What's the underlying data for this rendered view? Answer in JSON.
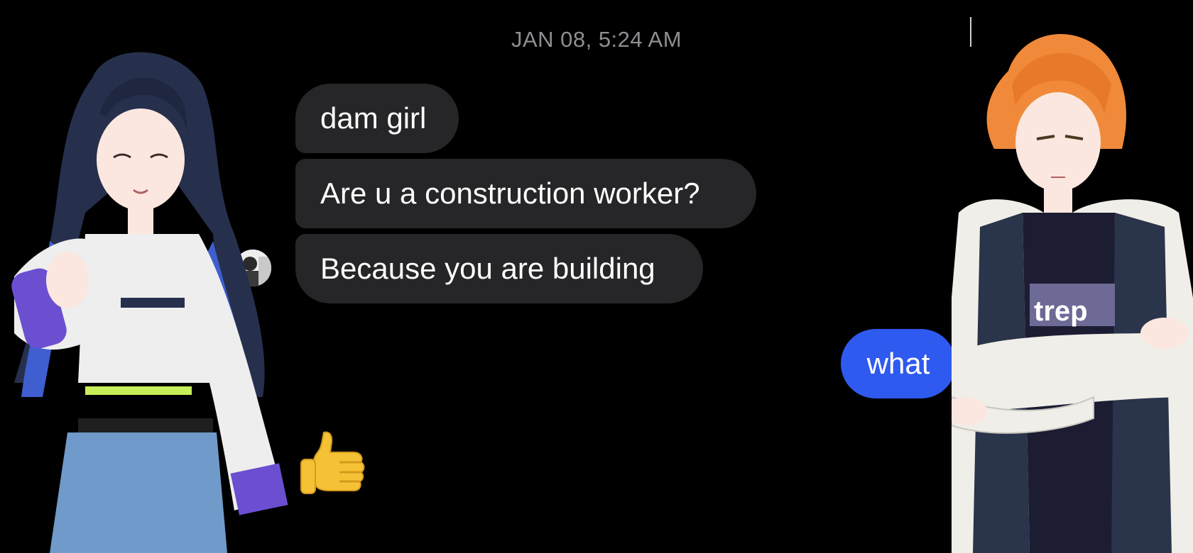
{
  "thread": {
    "timestamp": "JAN 08, 5:24 AM"
  },
  "messages": [
    {
      "direction": "incoming",
      "text": "dam girl"
    },
    {
      "direction": "incoming",
      "text": "Are u a construction worker?"
    },
    {
      "direction": "incoming",
      "text": "Because you are building"
    },
    {
      "direction": "outgoing",
      "text": "what"
    }
  ],
  "reaction": {
    "emoji": "thumbs-up"
  },
  "overlays": {
    "left_character": "anime-girl-thumbs-up",
    "right_character": "anime-boy-arms-crossed",
    "shirt_logo": "trep"
  },
  "colors": {
    "background": "#000000",
    "incoming_bubble": "#262628",
    "outgoing_bubble": "#2f5af0",
    "timestamp_text": "#8e8e93"
  }
}
